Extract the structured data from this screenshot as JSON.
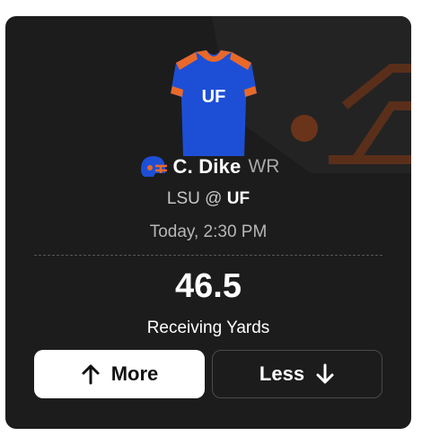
{
  "card": {
    "background": "#1c1c1c",
    "accent_orange": "#e8692a",
    "jersey_blue": "#1d4fd6"
  },
  "jersey": {
    "text": "UF",
    "icon": "jersey-icon"
  },
  "player": {
    "helmet_icon": "helmet-icon",
    "name": "C. Dike",
    "position": "WR"
  },
  "matchup": {
    "away": "LSU",
    "separator": "@",
    "home": "UF"
  },
  "game_time": "Today, 2:30 PM",
  "projection": {
    "line": "46.5",
    "stat": "Receiving Yards"
  },
  "actions": {
    "more_label": "More",
    "less_label": "Less"
  }
}
